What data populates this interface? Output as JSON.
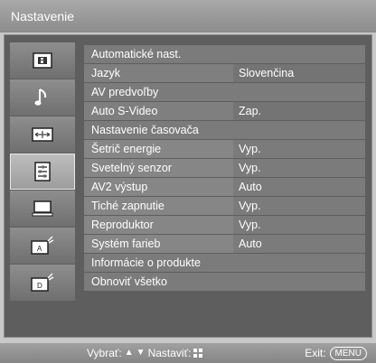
{
  "title": "Nastavenie",
  "sidebar": {
    "items": [
      {
        "icon": "picture-icon"
      },
      {
        "icon": "music-note-icon"
      },
      {
        "icon": "screen-aspect-icon"
      },
      {
        "icon": "settings-list-icon",
        "active": true
      },
      {
        "icon": "pc-monitor-icon"
      },
      {
        "icon": "analog-antenna-icon"
      },
      {
        "icon": "digital-antenna-icon"
      }
    ]
  },
  "menu": {
    "auto_setup": "Automatické nast.",
    "language_label": "Jazyk",
    "language_value": "Slovenčina",
    "av_presets": "AV predvoľby",
    "auto_svideo_label": "Auto S-Video",
    "auto_svideo_value": "Zap.",
    "timer_setup": "Nastavenie časovača",
    "power_saving_label": "Šetrič energie",
    "power_saving_value": "Vyp.",
    "light_sensor_label": "Svetelný senzor",
    "light_sensor_value": "Vyp.",
    "av2_output_label": "AV2 výstup",
    "av2_output_value": "Auto",
    "silent_on_label": "Tiché zapnutie",
    "silent_on_value": "Vyp.",
    "speaker_label": "Reproduktor",
    "speaker_value": "Vyp.",
    "color_system_label": "Systém farieb",
    "color_system_value": "Auto",
    "product_info": "Informácie o produkte",
    "reset_all": "Obnoviť všetko"
  },
  "footer": {
    "select_label": "Vybrať:",
    "set_label": "Nastaviť:",
    "exit_label": "Exit:",
    "menu_key": "MENU"
  }
}
